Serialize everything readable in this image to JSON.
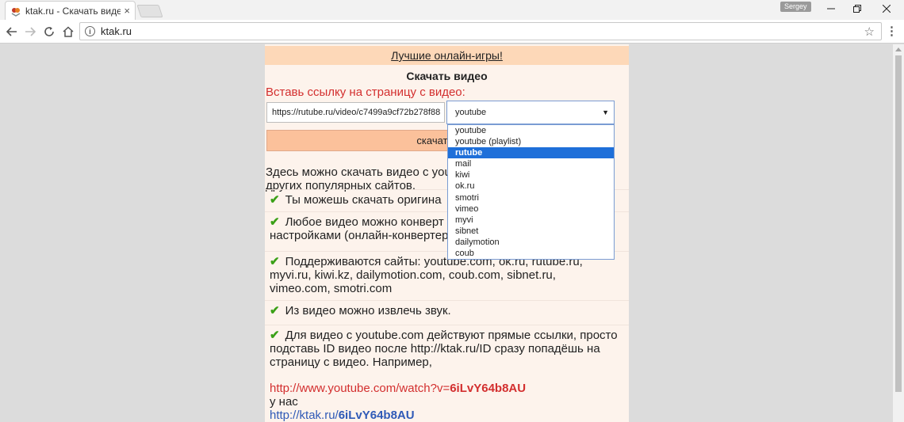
{
  "browser": {
    "tab_title": "ktak.ru - Скачать видео",
    "tab_close": "×",
    "profile_name": "Sergey",
    "address": "ktak.ru",
    "info_icon": "i",
    "icons": [
      "favicon",
      "close-icon",
      "minimize-icon",
      "restore-icon",
      "window-close-icon",
      "back-icon",
      "forward-icon",
      "reload-icon",
      "home-icon",
      "info-icon",
      "star-icon",
      "menu-icon"
    ]
  },
  "page": {
    "promo_link": "Лучшие онлайн-игры!",
    "title": "Скачать видео",
    "prompt": "Вставь ссылку на страницу с видео:",
    "url_value": "https://rutube.ru/video/c7499a9cf72b278f88",
    "select_value": "youtube",
    "download_button": "скачать ф",
    "intro_line1": "Здесь можно скачать видео с you",
    "intro_line2": "других популярных сайтов.",
    "features": [
      {
        "text": "Ты можешь скачать оригина"
      },
      {
        "text": "Любое видео можно конверт",
        "text2": "настройками (онлайн-конвертер"
      },
      {
        "text": "Поддерживаются сайты: youtube.com, ok.ru, rutube.ru,",
        "text2": "myvi.ru, kiwi.kz, dailymotion.com, coub.com, sibnet.ru,",
        "text3": "vimeo.com, smotri.com"
      },
      {
        "text": "Из видео можно извлечь звук."
      },
      {
        "text": "Для видео с youtube.com действуют прямые ссылки, просто",
        "text2": "подставь ID видео после http://ktak.ru/ID сразу попадёшь на",
        "text3": "страницу с видео. Например,"
      }
    ],
    "example": {
      "youtube_prefix": "http://www.youtube.com/watch?v=",
      "video_id": "6iLvY64b8AU",
      "connector": "у нас",
      "ktak_prefix": "http://ktak.ru/",
      "ktak_id": "6iLvY64b8AU"
    }
  },
  "dropdown": {
    "options": [
      "youtube",
      "youtube (playlist)",
      "rutube",
      "mail",
      "kiwi",
      "ok.ru",
      "smotri",
      "vimeo",
      "myvi",
      "sibnet",
      "dailymotion",
      "coub"
    ],
    "selected": "rutube"
  },
  "colors": {
    "promo_bg": "#fdd8b8",
    "content_bg": "#fdf3ec",
    "button_bg": "#fbc19b",
    "prompt_red": "#d32f2f",
    "check_green": "#3aa017",
    "link_blue": "#2f5ab7",
    "selected_blue": "#1e6fd9"
  }
}
